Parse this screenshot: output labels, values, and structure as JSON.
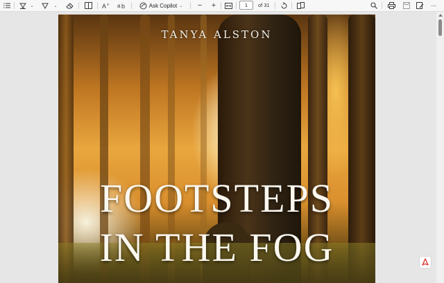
{
  "toolbar": {
    "ask_copilot_label": "Ask Copilot",
    "zoom_out_label": "−",
    "zoom_in_label": "+",
    "current_page": "1",
    "page_total": "of 31"
  },
  "cover": {
    "author": "TANYA ALSTON",
    "title_line1": "FOOTSTEPS",
    "title_line2": "IN THE FOG"
  },
  "colors": {
    "toolbar_bg": "#f7f7f7",
    "viewer_bg": "#e6e6e6",
    "pdf_badge_red": "#d9352b"
  },
  "icons": [
    "contents-icon",
    "highlight-icon",
    "draw-icon",
    "erase-icon",
    "page-view-icon",
    "read-aloud-icon",
    "translate-icon",
    "copilot-icon",
    "fit-page-icon",
    "rotate-icon",
    "two-page-icon",
    "search-icon",
    "print-icon",
    "save-icon",
    "save-as-icon",
    "more-icon",
    "pdf-icon"
  ]
}
